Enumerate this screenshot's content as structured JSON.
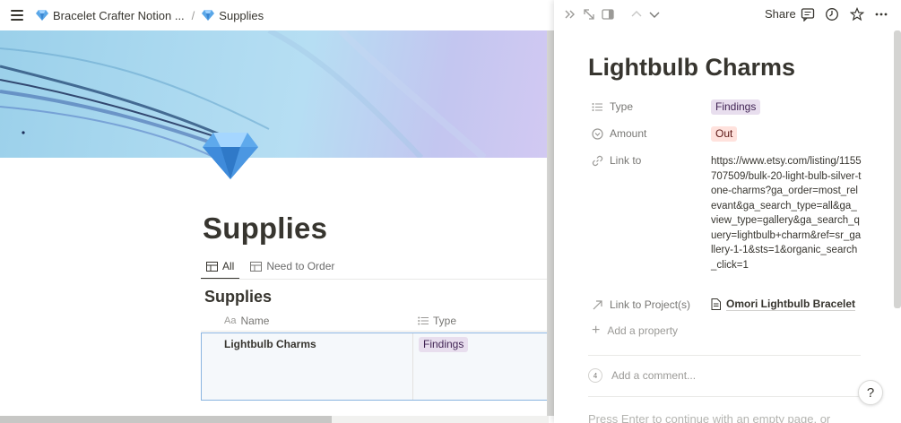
{
  "breadcrumb": {
    "workspace": "Bracelet Crafter Notion ...",
    "separator": "/",
    "current": "Supplies"
  },
  "page": {
    "title": "Supplies",
    "tabs": [
      {
        "label": "All",
        "active": true
      },
      {
        "label": "Need to Order",
        "active": false
      }
    ]
  },
  "database": {
    "title": "Supplies",
    "columns": [
      "Name",
      "Type"
    ],
    "rows": [
      {
        "name": "Lightbulb Charms",
        "type": "Findings"
      }
    ]
  },
  "peek_toolbar": {
    "share_label": "Share"
  },
  "record": {
    "title": "Lightbulb Charms",
    "properties": {
      "type_label": "Type",
      "type_value": "Findings",
      "amount_label": "Amount",
      "amount_value": "Out",
      "link_label": "Link to",
      "link_value": "https://www.etsy.com/listing/1155707509/bulk-20-light-bulb-silver-tone-charms?ga_order=most_relevant&ga_search_type=all&ga_view_type=gallery&ga_search_query=lightbulb+charm&ref=sr_gallery-1-1&sts=1&organic_search_click=1",
      "project_label": "Link to Project(s)",
      "project_value": "Omori Lightbulb Bracelet"
    },
    "add_property_label": "Add a property",
    "comment_count": "4",
    "comment_placeholder": "Add a comment...",
    "hint_text": "Press Enter to continue with an empty page, or"
  },
  "help_label": "?",
  "colors": {
    "tag_purple_bg": "#e8deee",
    "tag_red_bg": "#ffe2dd",
    "selection_border": "#8ab4e0",
    "gem_blue": "#4a90d9"
  }
}
